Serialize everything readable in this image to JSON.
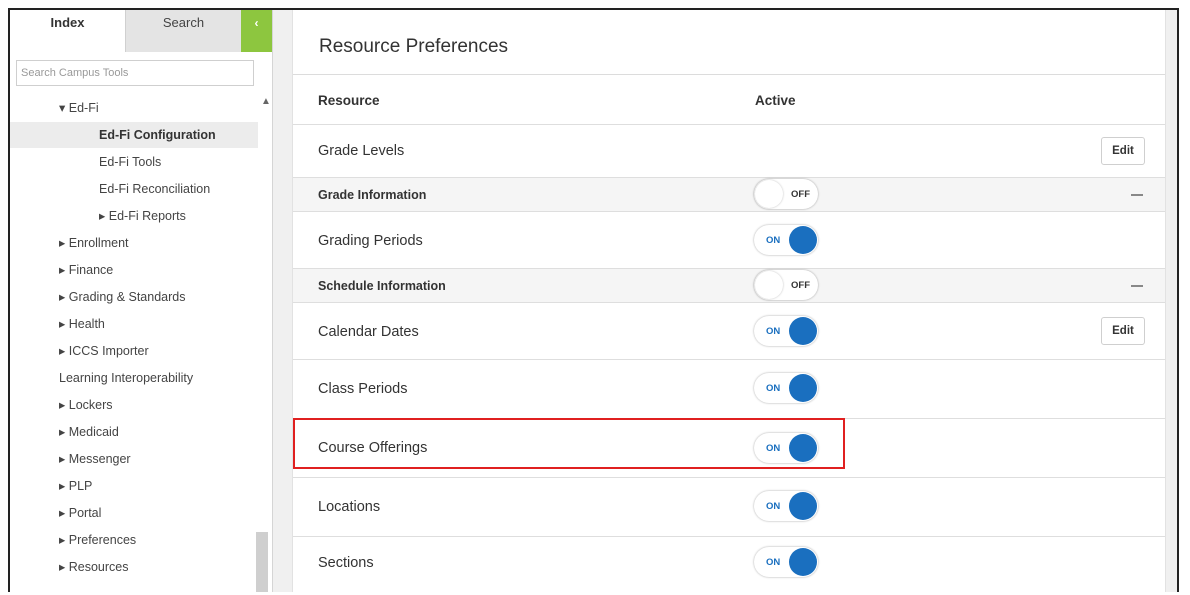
{
  "sidebar": {
    "tabs": {
      "index": "Index",
      "search": "Search"
    },
    "collapse_icon": "‹",
    "search_placeholder": "Search Campus Tools",
    "tree": [
      {
        "label": "▾ Ed-Fi"
      },
      {
        "label": "Ed-Fi Configuration",
        "selected": true
      },
      {
        "label": "Ed-Fi Tools"
      },
      {
        "label": "Ed-Fi Reconciliation"
      },
      {
        "label": "▸ Ed-Fi Reports"
      },
      {
        "label": "▸ Enrollment"
      },
      {
        "label": "▸ Finance"
      },
      {
        "label": "▸ Grading & Standards"
      },
      {
        "label": "▸ Health"
      },
      {
        "label": "▸ ICCS Importer"
      },
      {
        "label": "Learning Interoperability"
      },
      {
        "label": "▸ Lockers"
      },
      {
        "label": "▸ Medicaid"
      },
      {
        "label": "▸ Messenger"
      },
      {
        "label": "▸ PLP"
      },
      {
        "label": "▸ Portal"
      },
      {
        "label": "▸ Preferences"
      },
      {
        "label": "▸ Resources"
      }
    ]
  },
  "main": {
    "title": "Resource Preferences",
    "header": {
      "resource": "Resource",
      "active": "Active"
    },
    "rows": [
      {
        "label": "Grade Levels",
        "edit": "Edit"
      },
      {
        "label": "Grade Information",
        "section": true,
        "toggle": "OFF"
      },
      {
        "label": "Grading Periods",
        "toggle": "ON"
      },
      {
        "label": "Schedule Information",
        "section": true,
        "toggle": "OFF"
      },
      {
        "label": "Calendar Dates",
        "toggle": "ON",
        "edit": "Edit"
      },
      {
        "label": "Class Periods",
        "toggle": "ON"
      },
      {
        "label": "Course Offerings",
        "toggle": "ON"
      },
      {
        "label": "Locations",
        "toggle": "ON"
      },
      {
        "label": "Sections",
        "toggle": "ON"
      }
    ]
  },
  "colors": {
    "accent_green": "#8dc63f",
    "toggle_blue": "#1a6fbf",
    "highlight_red": "#e02020"
  }
}
